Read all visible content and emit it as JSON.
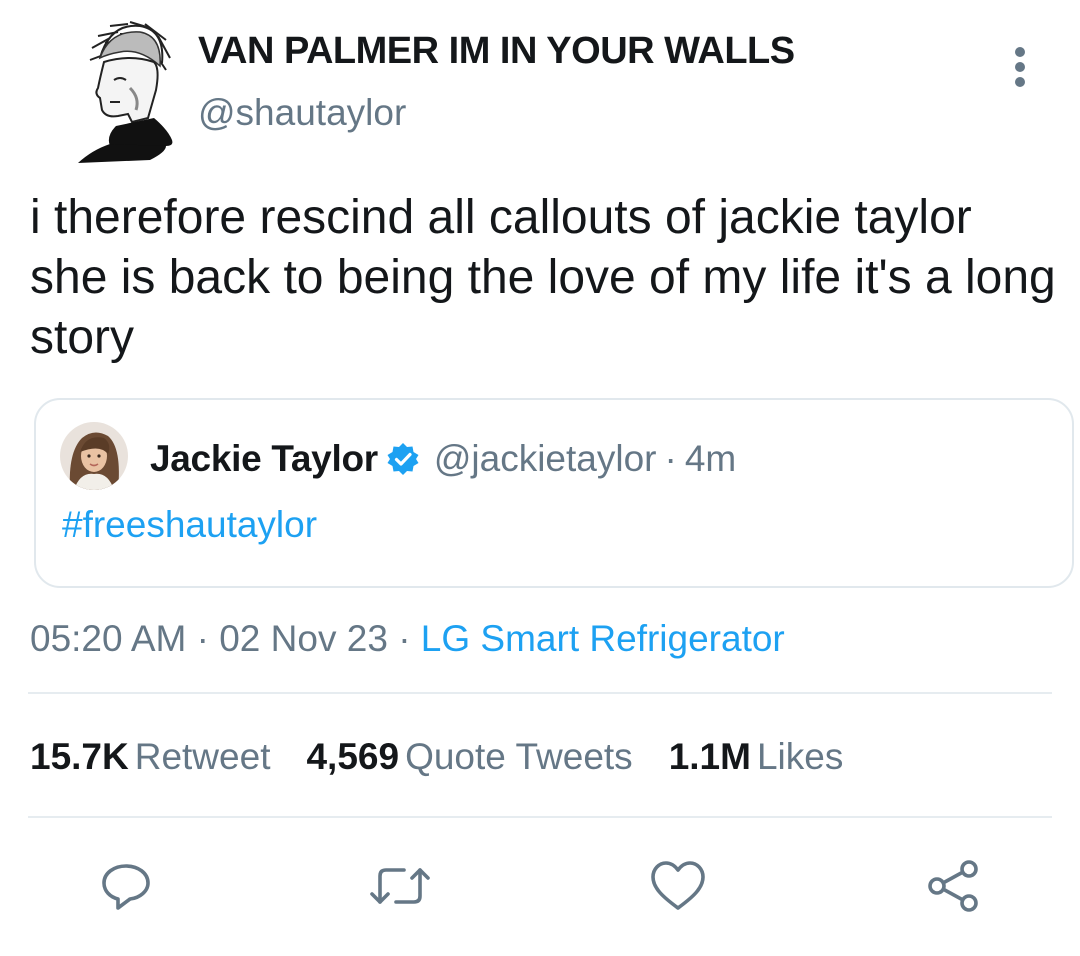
{
  "author": {
    "display_name": "VAN PALMER IM IN YOUR WALLS",
    "handle": "@shautaylor",
    "avatar_icon": "sketch-portrait-avatar"
  },
  "tweet": {
    "text": "i therefore rescind all callouts of jackie taylor she is back to being the love of my life it's a long story"
  },
  "quoted_tweet": {
    "name": "Jackie Taylor",
    "verified": true,
    "handle": "@jackietaylor",
    "separator": "·",
    "time": "4m",
    "text": "#freeshautaylor"
  },
  "meta": {
    "time": "05:20 AM",
    "date": "02 Nov 23",
    "separator": "·",
    "source": "LG Smart Refrigerator"
  },
  "stats": {
    "retweets": {
      "count": "15.7K",
      "label": "Retweet"
    },
    "quotes": {
      "count": "4,569",
      "label": "Quote Tweets"
    },
    "likes": {
      "count": "1.1M",
      "label": "Likes"
    }
  },
  "actions": [
    "reply-icon",
    "retweet-icon",
    "like-icon",
    "share-icon"
  ],
  "colors": {
    "accent": "#1da1f2",
    "secondary_text": "#657786",
    "primary_text": "#14171a",
    "border": "#e1e8ed"
  }
}
